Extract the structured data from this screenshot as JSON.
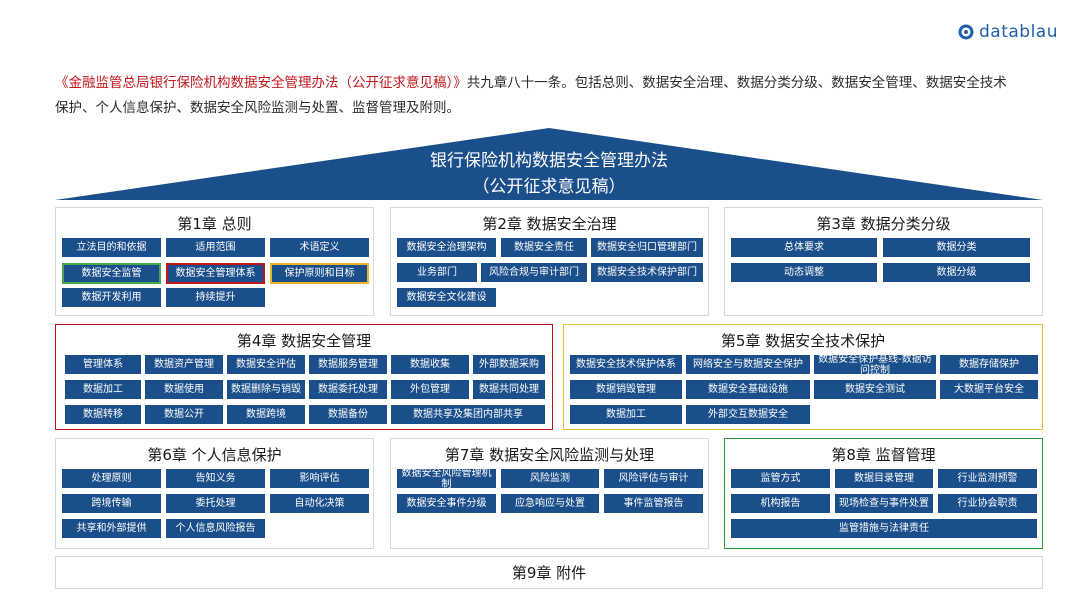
{
  "brand": {
    "name": "datablau"
  },
  "intro": {
    "title": "《金融监管总局银行保险机构数据安全管理办法（公开征求意见稿）》",
    "text": "共九章八十一条。包括总则、数据安全治理、数据分类分级、数据安全管理、数据安全技术保护、个人信息保护、数据安全风险监测与处置、监督管理及附则。"
  },
  "header": {
    "line1": "银行保险机构数据安全管理办法",
    "line2": "（公开征求意见稿）"
  },
  "colors": {
    "item_bg": "#1a4f8b",
    "accent_red": "#c0151b",
    "accent_yellow": "#f0c030",
    "accent_green": "#2e9a3a"
  },
  "chapters": [
    {
      "title": "第1章 总则",
      "items": [
        "立法目的和依据",
        "适用范围",
        "术语定义",
        "数据安全监管",
        "数据安全管理体系",
        "保护原则和目标",
        "数据开发利用",
        "持续提升"
      ]
    },
    {
      "title": "第2章 数据安全治理",
      "items": [
        "数据安全治理架构",
        "数据安全责任",
        "数据安全归口管理部门",
        "业务部门",
        "风险合规与审计部门",
        "数据安全技术保护部门",
        "数据安全文化建设"
      ]
    },
    {
      "title": "第3章 数据分类分级",
      "items": [
        "总体要求",
        "数据分类",
        "动态调整",
        "数据分级"
      ]
    },
    {
      "title": "第4章 数据安全管理",
      "items": [
        "管理体系",
        "数据资产管理",
        "数据安全评估",
        "数据服务管理",
        "数据收集",
        "外部数据采购",
        "数据加工",
        "数据使用",
        "数据删除与销毁",
        "数据委托处理",
        "外包管理",
        "数据共同处理",
        "数据转移",
        "数据公开",
        "数据跨境",
        "数据备份",
        "数据共享及集团内部共享"
      ]
    },
    {
      "title": "第5章 数据安全技术保护",
      "items": [
        "数据安全技术保护体系",
        "网络安全与数据安全保护",
        "数据安全保护基线-数据访问控制",
        "数据存储保护",
        "数据销毁管理",
        "数据安全基础设施",
        "数据安全测试",
        "大数据平台安全",
        "数据加工",
        "外部交互数据安全"
      ]
    },
    {
      "title": "第6章 个人信息保护",
      "items": [
        "处理原则",
        "告知义务",
        "影响评估",
        "跨境传输",
        "委托处理",
        "自动化决策",
        "共享和外部提供",
        "个人信息风险报告"
      ]
    },
    {
      "title": "第7章 数据安全风险监测与处理",
      "items": [
        "数据安全风险管理机制",
        "风险监测",
        "风险评估与审计",
        "数据安全事件分级",
        "应急响应与处置",
        "事件监管报告"
      ]
    },
    {
      "title": "第8章 监督管理",
      "items": [
        "监管方式",
        "数据目录管理",
        "行业监测预警",
        "机构报告",
        "现场检查与事件处置",
        "行业协会职责",
        "监管措施与法律责任"
      ]
    },
    {
      "title": "第9章 附件",
      "items": []
    }
  ]
}
